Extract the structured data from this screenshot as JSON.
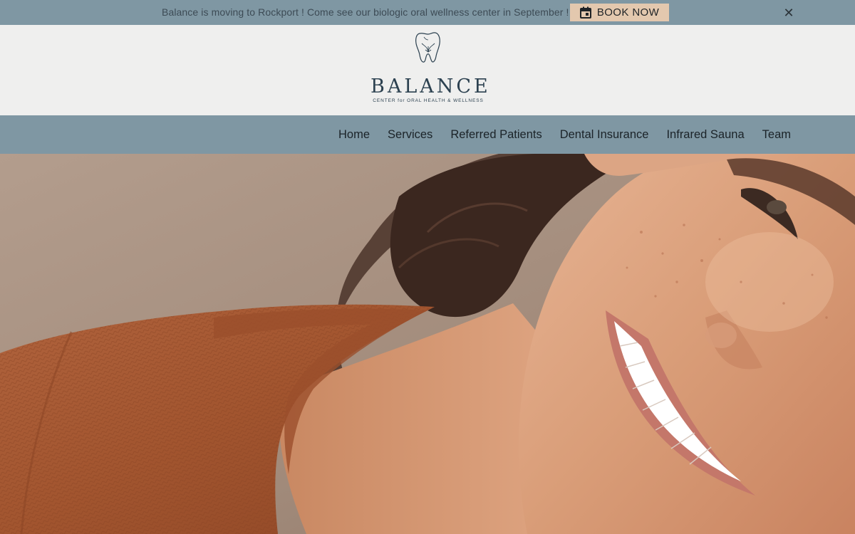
{
  "announcement": {
    "text": "Balance is moving to Rockport ! Come see our biologic oral wellness center in September !",
    "book_label": "BOOK NOW",
    "book_icon": "calendar-icon",
    "close_icon": "close-icon",
    "close_glyph": "✕"
  },
  "logo": {
    "wordmark": "BALANCE",
    "tagline": "CENTER for ORAL HEALTH & WELLNESS",
    "icon": "tooth-icon"
  },
  "nav": {
    "items": [
      {
        "label": "Home"
      },
      {
        "label": "Services"
      },
      {
        "label": "Referred Patients"
      },
      {
        "label": "Dental Insurance"
      },
      {
        "label": "Infrared Sauna"
      },
      {
        "label": "Team"
      }
    ]
  },
  "colors": {
    "bar": "#7f97a3",
    "header_bg": "#efefee",
    "button_bg": "#e3c8ae",
    "logo_text": "#2c4150"
  },
  "hero": {
    "image": "hero-smiling-woman-photo"
  }
}
